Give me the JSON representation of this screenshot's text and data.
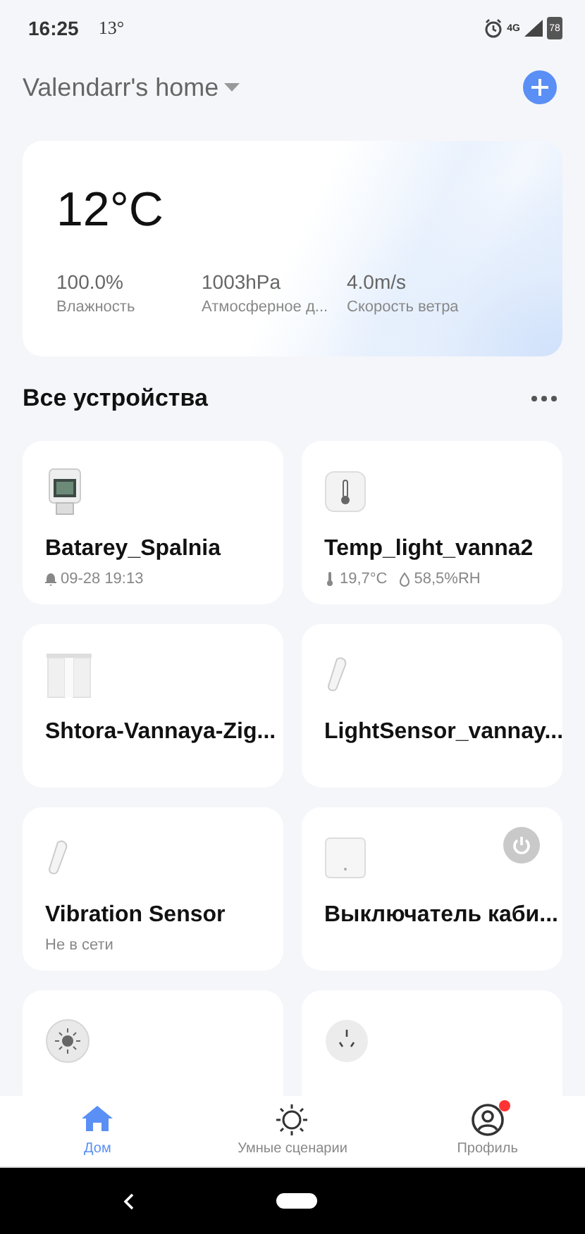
{
  "status_bar": {
    "time": "16:25",
    "weather": "13°",
    "network": "4G",
    "battery": "78"
  },
  "header": {
    "home_name": "Valendarr's home"
  },
  "weather": {
    "temperature": "12°C",
    "stats": [
      {
        "value": "100.0%",
        "label": "Влажность"
      },
      {
        "value": "1003hPa",
        "label": "Атмосферное д..."
      },
      {
        "value": "4.0m/s",
        "label": "Скорость ветра"
      }
    ]
  },
  "section": {
    "title": "Все устройства"
  },
  "devices": [
    {
      "name": "Batarey_Spalnia",
      "kind": "thermostat",
      "power_button": false,
      "details": [
        {
          "kind": "alarm",
          "text": "09-28 19:13"
        }
      ]
    },
    {
      "name": "Temp_light_vanna2",
      "kind": "climate_sensor",
      "power_button": false,
      "details": [
        {
          "kind": "temperature",
          "text": "19,7°C"
        },
        {
          "kind": "humidity",
          "text": "58,5%RH"
        }
      ]
    },
    {
      "name": "Shtora-Vannaya-Zig...",
      "kind": "curtain",
      "power_button": false
    },
    {
      "name": "LightSensor_vannay...",
      "kind": "stick",
      "power_button": false
    },
    {
      "name": "Vibration Sensor",
      "kind": "stick",
      "power_button": false,
      "details": [
        {
          "kind": "offline",
          "text": "Не в сети"
        }
      ]
    },
    {
      "name": "Выключатель каби...",
      "kind": "hub",
      "power_button": true
    },
    {
      "kind": "light",
      "power_button": false
    },
    {
      "kind": "ir",
      "power_button": false
    }
  ],
  "tabs": [
    {
      "label": "Дом",
      "kind": "home",
      "selected": true,
      "badge": false
    },
    {
      "label": "Умные сценарии",
      "kind": "scenes",
      "selected": false,
      "badge": false
    },
    {
      "label": "Профиль",
      "kind": "profile",
      "selected": false,
      "badge": true
    }
  ]
}
